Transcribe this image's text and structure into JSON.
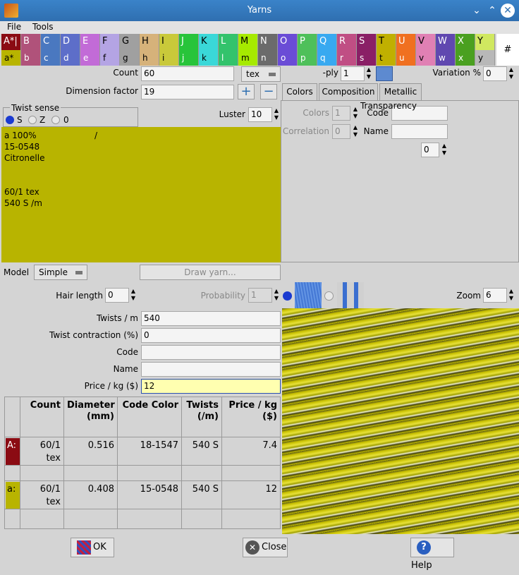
{
  "window": {
    "title": "Yarns"
  },
  "menu": {
    "file": "File",
    "tools": "Tools"
  },
  "palette_upper": [
    {
      "label": "A*|",
      "color": "#8b0b13"
    },
    {
      "label": "B",
      "color": "#b0527a"
    },
    {
      "label": "C",
      "color": "#4a78c0"
    },
    {
      "label": "D",
      "color": "#5d6ec9"
    },
    {
      "label": "E",
      "color": "#c26bd7"
    },
    {
      "label": "F",
      "color": "#b4a4e4"
    },
    {
      "label": "G",
      "color": "#a0a0a0"
    },
    {
      "label": "H",
      "color": "#d6b27a"
    },
    {
      "label": "I",
      "color": "#c9c93a"
    },
    {
      "label": "J",
      "color": "#28c43a"
    },
    {
      "label": "K",
      "color": "#3ad8d8"
    },
    {
      "label": "L",
      "color": "#33c36c"
    },
    {
      "label": "M",
      "color": "#a6ea00"
    },
    {
      "label": "N",
      "color": "#6b6b6b"
    },
    {
      "label": "O",
      "color": "#6a4cd6"
    },
    {
      "label": "P",
      "color": "#4ec05a"
    },
    {
      "label": "Q",
      "color": "#38a9f0"
    },
    {
      "label": "R",
      "color": "#c04e84"
    },
    {
      "label": "S",
      "color": "#8a1f66"
    },
    {
      "label": "T",
      "color": "#c0b000"
    },
    {
      "label": "U",
      "color": "#f07020"
    },
    {
      "label": "V",
      "color": "#e080b4"
    },
    {
      "label": "W",
      "color": "#6048b0"
    },
    {
      "label": "X",
      "color": "#4aa020"
    },
    {
      "label": "Y",
      "color": "#d0e860"
    }
  ],
  "palette_lower": [
    {
      "label": "a*",
      "color": "#b8b400"
    },
    {
      "label": "b",
      "color": "#b0527a"
    },
    {
      "label": "c",
      "color": "#4a78c0"
    },
    {
      "label": "d",
      "color": "#5d6ec9"
    },
    {
      "label": "e",
      "color": "#c26bd7"
    },
    {
      "label": "f",
      "color": "#b4a4e4"
    },
    {
      "label": "g",
      "color": "#a0a0a0"
    },
    {
      "label": "h",
      "color": "#d6b27a"
    },
    {
      "label": "i",
      "color": "#c9c93a"
    },
    {
      "label": "j",
      "color": "#28c43a"
    },
    {
      "label": "k",
      "color": "#3ad8d8"
    },
    {
      "label": "l",
      "color": "#33c36c"
    },
    {
      "label": "m",
      "color": "#a6ea00"
    },
    {
      "label": "n",
      "color": "#6b6b6b"
    },
    {
      "label": "o",
      "color": "#6a4cd6"
    },
    {
      "label": "p",
      "color": "#4ec05a"
    },
    {
      "label": "q",
      "color": "#38a9f0"
    },
    {
      "label": "r",
      "color": "#c04e84"
    },
    {
      "label": "s",
      "color": "#8a1f66"
    },
    {
      "label": "t",
      "color": "#c0b000"
    },
    {
      "label": "u",
      "color": "#f07020"
    },
    {
      "label": "v",
      "color": "#e080b4"
    },
    {
      "label": "w",
      "color": "#6048b0"
    },
    {
      "label": "x",
      "color": "#4aa020"
    },
    {
      "label": "y",
      "color": "#b8b8b8"
    }
  ],
  "palette_hash": "#",
  "form": {
    "count_label": "Count",
    "count_value": "60",
    "unit": "tex",
    "ply_label": "-ply",
    "ply_value": "1",
    "variation_label": "Variation %",
    "variation_value": "0",
    "dimension_label": "Dimension factor",
    "dimension_value": "19",
    "plus": "+",
    "minus": "−",
    "twist_sense_label": "Twist sense",
    "twist_s": "S",
    "twist_z": "Z",
    "twist_0": "0",
    "luster_label": "Luster",
    "luster_value": "10"
  },
  "tabs": {
    "colors": "Colors",
    "composition": "Composition",
    "metallic": "Metallic"
  },
  "colors_panel": {
    "colors_label": "Colors",
    "colors_value": "1",
    "correlation_label": "Correlation",
    "correlation_value": "0",
    "code_label": "Code",
    "code_value": "",
    "name_label": "Name",
    "name_value": "",
    "transparency_label": "Transparency",
    "transparency_value": "0"
  },
  "yarn_info": {
    "line1": "a 100%",
    "slash": "/",
    "line2": "15-0548",
    "line3": "Citronelle",
    "line4": "60/1 tex",
    "line5": "540 S /m",
    "color": "#b8b400"
  },
  "model": {
    "label": "Model",
    "value": "Simple",
    "draw_button": "Draw yarn..."
  },
  "hair": {
    "label": "Hair length",
    "value": "0",
    "probability_label": "Probability",
    "probability_value": "1"
  },
  "zoom": {
    "label": "Zoom",
    "value": "6"
  },
  "fields": {
    "twists_label": "Twists / m",
    "twists_value": "540",
    "contraction_label": "Twist contraction (%)",
    "contraction_value": "0",
    "code_label": "Code",
    "code_value": "",
    "name_label": "Name",
    "name_value": "",
    "price_label": "Price / kg ($)",
    "price_value": "12"
  },
  "table": {
    "headers": {
      "count": "Count",
      "diameter": "Diameter (mm)",
      "code_color": "Code Color",
      "twists": "Twists (/m)",
      "price": "Price / kg ($)"
    },
    "rows": [
      {
        "key": "A:",
        "color": "#8b0b13",
        "count": "60/1 tex",
        "diameter": "0.516",
        "code": "18-1547",
        "twists": "540 S",
        "price": "7.4"
      },
      {
        "key": "a:",
        "color": "#b8b400",
        "count": "60/1 tex",
        "diameter": "0.408",
        "code": "15-0548",
        "twists": "540 S",
        "price": "12"
      }
    ]
  },
  "buttons": {
    "ok": "OK",
    "close": "Close",
    "help": "Help"
  }
}
